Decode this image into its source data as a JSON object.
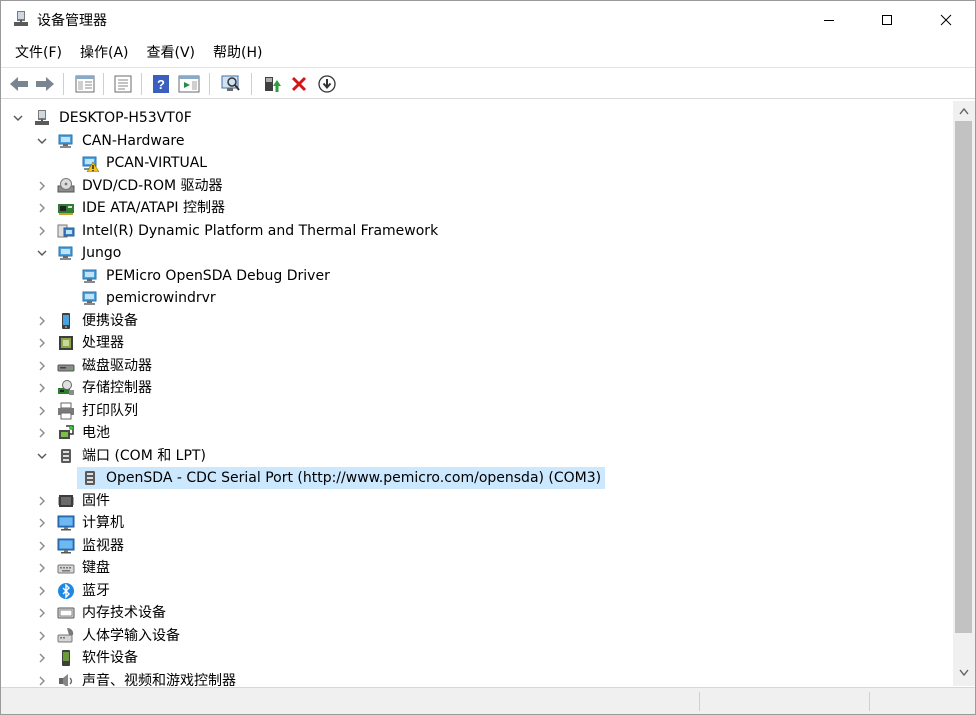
{
  "window": {
    "title": "设备管理器"
  },
  "menu": [
    "文件(F)",
    "操作(A)",
    "查看(V)",
    "帮助(H)"
  ],
  "toolbar": {
    "icons": [
      "back-arrow-icon",
      "forward-arrow-icon",
      "show-hide-tree-icon",
      "properties-icon",
      "help-icon",
      "action-pane-icon",
      "scan-hardware-icon",
      "update-driver-icon",
      "uninstall-device-icon",
      "disable-device-icon"
    ]
  },
  "tree": {
    "root": "DESKTOP-H53VT0F",
    "rows": [
      {
        "label": "CAN-Hardware",
        "level": 1,
        "expanded": true,
        "icon": "network-device-icon"
      },
      {
        "label": "PCAN-VIRTUAL",
        "level": 2,
        "icon": "warning-device-icon"
      },
      {
        "label": "DVD/CD-ROM 驱动器",
        "level": 1,
        "expanded": false,
        "icon": "dvd-drive-icon"
      },
      {
        "label": "IDE ATA/ATAPI 控制器",
        "level": 1,
        "expanded": false,
        "icon": "ide-controller-icon"
      },
      {
        "label": "Intel(R) Dynamic Platform and Thermal Framework",
        "level": 1,
        "expanded": false,
        "icon": "intel-framework-icon"
      },
      {
        "label": "Jungo",
        "level": 1,
        "expanded": true,
        "icon": "network-device-icon"
      },
      {
        "label": "PEMicro OpenSDA Debug Driver",
        "level": 2,
        "icon": "network-device-icon"
      },
      {
        "label": "pemicrowindrvr",
        "level": 2,
        "icon": "network-device-icon"
      },
      {
        "label": "便携设备",
        "level": 1,
        "expanded": false,
        "icon": "portable-device-icon"
      },
      {
        "label": "处理器",
        "level": 1,
        "expanded": false,
        "icon": "processor-icon"
      },
      {
        "label": "磁盘驱动器",
        "level": 1,
        "expanded": false,
        "icon": "disk-drive-icon"
      },
      {
        "label": "存储控制器",
        "level": 1,
        "expanded": false,
        "icon": "storage-controller-icon"
      },
      {
        "label": "打印队列",
        "level": 1,
        "expanded": false,
        "icon": "printer-icon"
      },
      {
        "label": "电池",
        "level": 1,
        "expanded": false,
        "icon": "battery-icon"
      },
      {
        "label": "端口 (COM 和 LPT)",
        "level": 1,
        "expanded": true,
        "icon": "port-icon"
      },
      {
        "label": "OpenSDA - CDC Serial Port (http://www.pemicro.com/opensda) (COM3)",
        "level": 2,
        "icon": "port-icon",
        "selected": true
      },
      {
        "label": "固件",
        "level": 1,
        "expanded": false,
        "icon": "firmware-icon"
      },
      {
        "label": "计算机",
        "level": 1,
        "expanded": false,
        "icon": "computer-icon"
      },
      {
        "label": "监视器",
        "level": 1,
        "expanded": false,
        "icon": "monitor-icon"
      },
      {
        "label": "键盘",
        "level": 1,
        "expanded": false,
        "icon": "keyboard-icon"
      },
      {
        "label": "蓝牙",
        "level": 1,
        "expanded": false,
        "icon": "bluetooth-icon"
      },
      {
        "label": "内存技术设备",
        "level": 1,
        "expanded": false,
        "icon": "memory-device-icon"
      },
      {
        "label": "人体学输入设备",
        "level": 1,
        "expanded": false,
        "icon": "hid-icon"
      },
      {
        "label": "软件设备",
        "level": 1,
        "expanded": false,
        "icon": "software-device-icon"
      },
      {
        "label": "声音、视频和游戏控制器",
        "level": 1,
        "expanded": false,
        "icon": "sound-icon"
      }
    ]
  },
  "colors": {
    "selection": "#cce8ff",
    "chevron": "#555555",
    "scroll_thumb": "#c2c2c2"
  }
}
